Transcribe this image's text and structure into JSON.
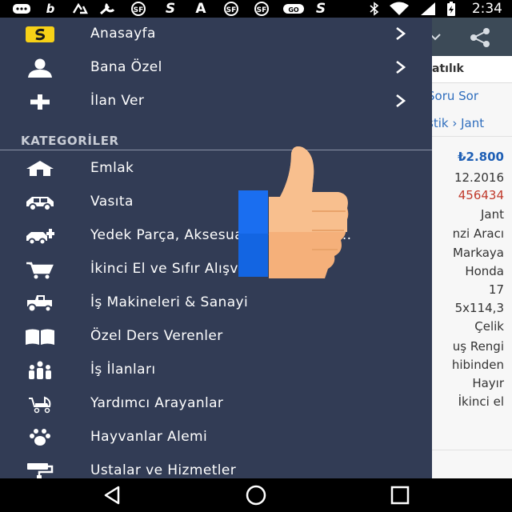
{
  "status_bar": {
    "time": "2:34",
    "left_icons": [
      "message-icon",
      "b-app-icon",
      "recycle-icon",
      "wrench-icon",
      "sahibinden-icon",
      "s-app-icon",
      "a-app-icon",
      "sahibinden-icon",
      "sahibinden-icon",
      "game-icon",
      "s-app-icon"
    ],
    "right_icons": [
      "bluetooth-icon",
      "wifi-icon",
      "signal-icon",
      "battery-charging-icon"
    ],
    "left_glyphs": {
      "b": "b",
      "a": "A",
      "s": "S",
      "sf": "SF",
      "game": "GO"
    }
  },
  "drawer": {
    "top_items": [
      {
        "label": "Anasayfa",
        "icon": "sahibinden-logo-icon"
      },
      {
        "label": "Bana Özel",
        "icon": "user-icon"
      },
      {
        "label": "İlan Ver",
        "icon": "plus-icon"
      }
    ],
    "section_header": "KATEGORİLER",
    "categories": [
      {
        "label": "Emlak",
        "icon": "house-icon"
      },
      {
        "label": "Vasıta",
        "icon": "car-icon"
      },
      {
        "label": "Yedek Parça, Aksesuar, Donanım &...",
        "icon": "car-parts-icon"
      },
      {
        "label": "İkinci El ve Sıfır Alışveriş",
        "icon": "shopping-cart-icon"
      },
      {
        "label": "İş Makineleri & Sanayi",
        "icon": "tractor-icon"
      },
      {
        "label": "Özel Ders Verenler",
        "icon": "book-icon"
      },
      {
        "label": "İş İlanları",
        "icon": "people-icon"
      },
      {
        "label": "Yardımcı Arayanlar",
        "icon": "stroller-icon"
      },
      {
        "label": "Hayvanlar Alemi",
        "icon": "paw-icon"
      },
      {
        "label": "Ustalar ve Hizmetler",
        "icon": "paint-roller-icon"
      }
    ],
    "colors": {
      "background": "#323c55",
      "text": "#ffffff",
      "header": "#c9cdd6",
      "logo_yellow": "#f7d117"
    }
  },
  "background_page": {
    "title_fragment": "atılık",
    "question_link": "Soru Sor",
    "breadcrumb": "stik › Jant",
    "price": "₺2.800",
    "rows": [
      "12.2016",
      "456434",
      "Jant",
      "nzi Aracı",
      "Markaya",
      "Honda",
      "17",
      "5x114,3",
      "Çelik",
      "uş Rengi",
      "hibinden",
      "Hayır",
      "İkinci el"
    ],
    "colors": {
      "toolbar": "#3c4a57",
      "link": "#2e6dbd",
      "price": "#1e5fb5",
      "id_red": "#c0392b"
    }
  },
  "overlay": {
    "icon": "thumbs-up-icon",
    "colors": {
      "blue": "#1a6ef0",
      "skin": "#f5b07a"
    }
  },
  "nav_bar": {
    "buttons": [
      "back-icon",
      "home-icon",
      "recents-icon"
    ]
  }
}
